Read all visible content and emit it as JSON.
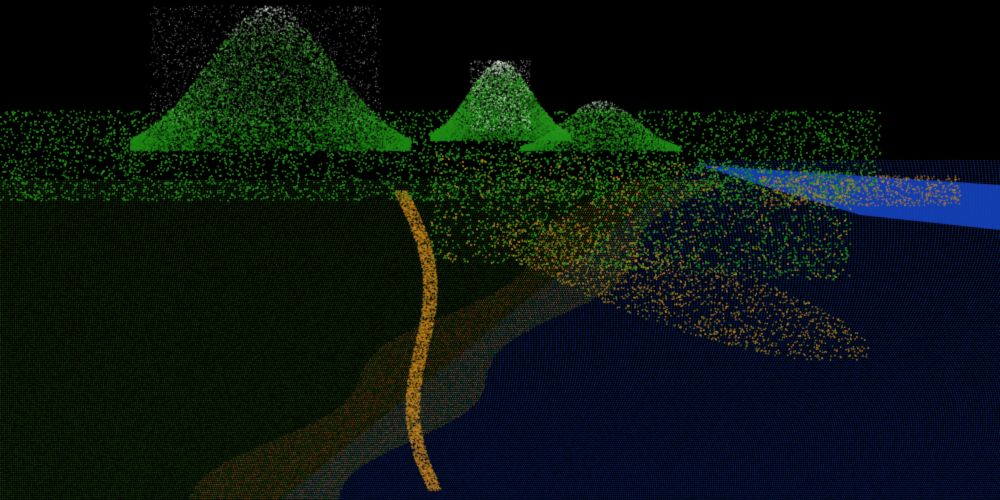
{
  "scene": {
    "kind": "terrain-point-cloud",
    "background_color": "#000000",
    "palette": {
      "water_deep": "#0b2a8a",
      "water_shallow": "#1646c8",
      "shore": "#c8861e",
      "lowland": "#3d7a1e",
      "forest": "#1f8a16",
      "highland": "#3fae2e",
      "peak": "#e8f2e8"
    }
  }
}
